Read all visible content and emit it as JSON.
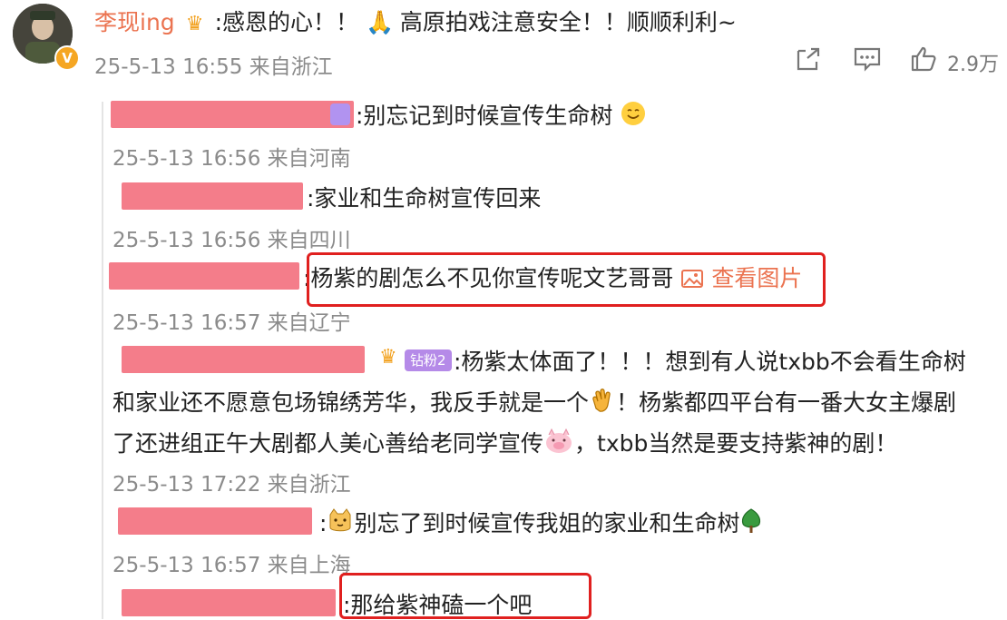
{
  "main_comment": {
    "username": "李现ing",
    "text_part1": ":感恩的心！！",
    "text_part2": "高原拍戏注意安全！！顺顺利利~",
    "timestamp": "25-5-13 16:55",
    "location": "来自浙江",
    "like_count": "2.9万",
    "verified_badge": "V"
  },
  "replies": [
    {
      "text": ":别忘记到时候宣传生命树",
      "timestamp": "25-5-13 16:56",
      "location": "来自河南"
    },
    {
      "text": ":家业和生命树宣传回来",
      "timestamp": "25-5-13 16:56",
      "location": "来自四川"
    },
    {
      "text": ":杨紫的剧怎么不见你宣传呢文艺哥哥",
      "image_link": "查看图片",
      "timestamp": "25-5-13 16:57",
      "location": "来自辽宁"
    },
    {
      "badge": "钻粉2",
      "line1": ":杨紫太体面了！！！想到有人说txbb不会看生命树",
      "line2a": "和家业还不愿意包场锦绣芳华，我反手就是一个",
      "line2b": "！杨紫都四平台有一番大女主爆剧",
      "line3a": "了还进组正午大剧都人美心善给老同学宣传",
      "line3b": "，txbb当然是要支持紫神的剧！",
      "timestamp": "25-5-13 17:22",
      "location": "来自浙江"
    },
    {
      "prefix": ":",
      "text": "别忘了到时候宣传我姐的家业和生命树",
      "timestamp": "25-5-13 16:57",
      "location": "来自上海"
    },
    {
      "text": ":那给紫神磕一个吧"
    }
  ],
  "colors": {
    "username": "#eb7350",
    "meta": "#8b8b8b",
    "highlight": "#e0201f",
    "redaction": "#f47d8a"
  },
  "icons": [
    "share-icon",
    "comment-icon",
    "like-icon",
    "crown-icon",
    "image-icon"
  ]
}
